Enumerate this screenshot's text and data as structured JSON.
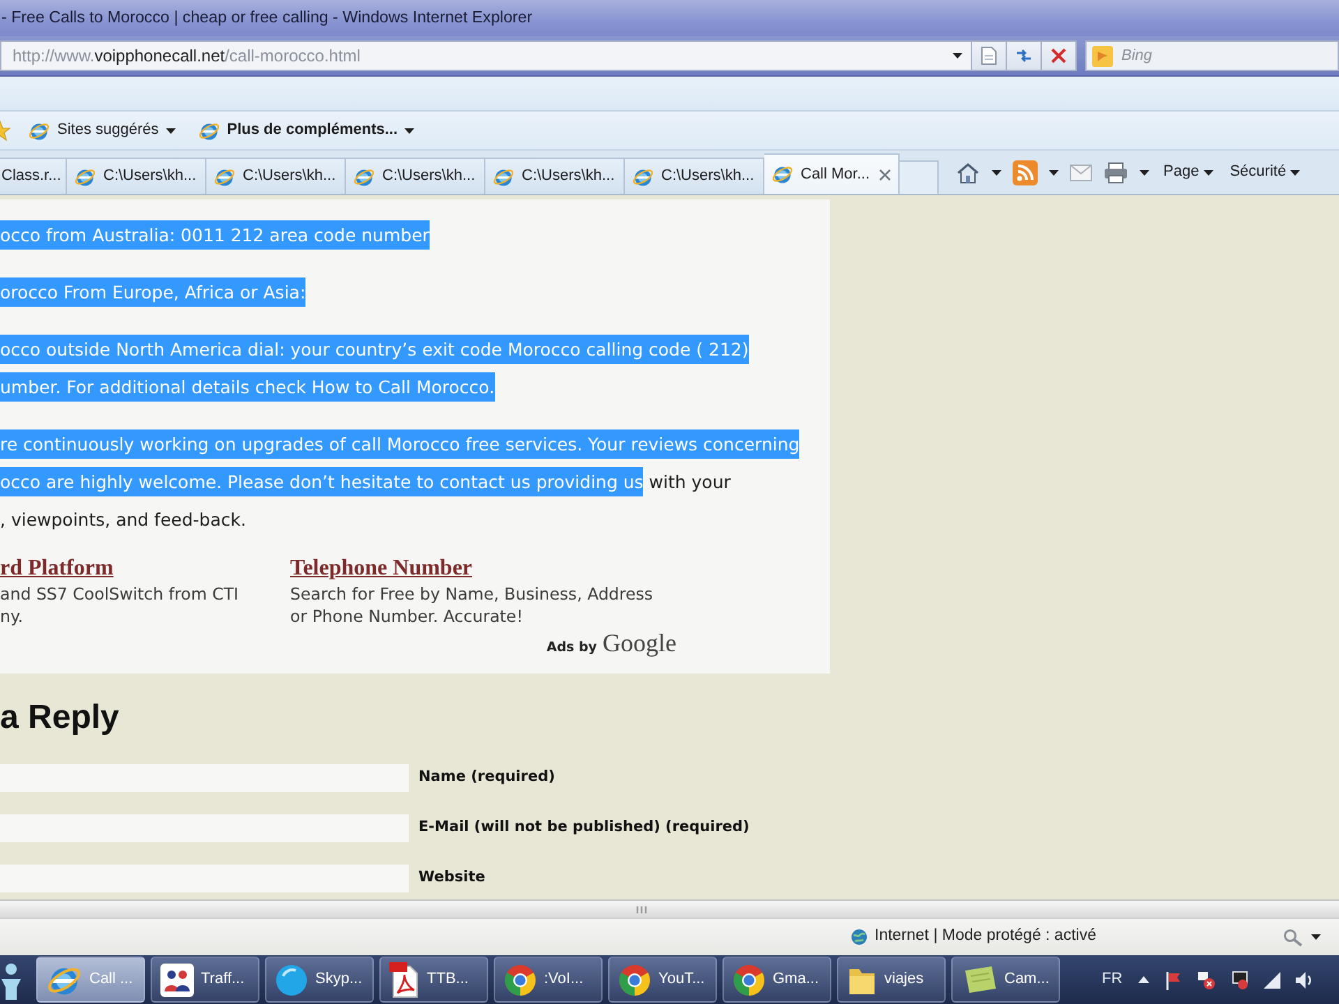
{
  "window": {
    "title": "- Free Calls to Morocco | cheap or free calling - Windows Internet Explorer"
  },
  "address_bar": {
    "url": [
      {
        "text": "http://www.",
        "kind": "dim"
      },
      {
        "text": "voipphonecall.net",
        "kind": "host"
      },
      {
        "text": "/call-morocco.html",
        "kind": "dim"
      }
    ]
  },
  "search": {
    "placeholder": "Bing"
  },
  "favorites_bar": {
    "items": [
      {
        "label": "Sites suggérés",
        "bold": false
      },
      {
        "label": "Plus de compléments...",
        "bold": true
      }
    ]
  },
  "tabs": [
    {
      "label": "Class.r...",
      "kind": "clipped",
      "selected": false
    },
    {
      "label": "C:\\Users\\kh...",
      "kind": "page",
      "selected": false
    },
    {
      "label": "C:\\Users\\kh...",
      "kind": "page",
      "selected": false
    },
    {
      "label": "C:\\Users\\kh...",
      "kind": "page",
      "selected": false
    },
    {
      "label": "C:\\Users\\kh...",
      "kind": "page",
      "selected": false
    },
    {
      "label": "C:\\Users\\kh...",
      "kind": "page",
      "selected": false
    },
    {
      "label": "Call Mor...",
      "kind": "page",
      "selected": true
    }
  ],
  "command_bar": {
    "menus": [
      "Page",
      "Sécurité"
    ]
  },
  "article": {
    "paragraphs": [
      {
        "segments": [
          {
            "text": "occo from Australia: 0011 212 area code number",
            "selected": true
          }
        ]
      },
      {
        "segments": [
          {
            "text": "orocco From Europe, Africa or Asia:",
            "selected": true
          }
        ]
      },
      {
        "segments": [
          {
            "text": "occo outside North America dial: your country’s exit code Morocco calling code ( 212)\number. For additional details check How to Call Morocco.",
            "selected": true
          }
        ]
      },
      {
        "segments": [
          {
            "text": "re continuously working on upgrades of call Morocco free services. Your reviews concerning\nocco are highly welcome. Please don’t hesitate to contact us providing us",
            "selected": true
          },
          {
            "text": " with your\n, viewpoints, and feed-back.",
            "selected": false
          }
        ]
      }
    ]
  },
  "ads": {
    "items": [
      {
        "title": "rd Platform",
        "description": "and SS7 CoolSwitch from CTI\nny."
      },
      {
        "title": "Telephone Number",
        "description": "Search for Free by Name, Business, Address\nor Phone Number. Accurate!"
      }
    ],
    "label": "Ads by",
    "brand": "Google"
  },
  "reply_form": {
    "heading": "a Reply",
    "fields": [
      {
        "label": "Name (required)"
      },
      {
        "label": "E-Mail (will not be published) (required)"
      },
      {
        "label": "Website"
      }
    ]
  },
  "status_bar": {
    "zone": "Internet | Mode protégé : activé"
  },
  "taskbar": {
    "items": [
      {
        "label": "Call ...",
        "kind": "ie",
        "selected": true
      },
      {
        "label": "Traff...",
        "kind": "people",
        "selected": false
      },
      {
        "label": "Skyp...",
        "kind": "skype",
        "selected": false
      },
      {
        "label": "TTB...",
        "kind": "pdf",
        "selected": false
      },
      {
        "label": ":VoI...",
        "kind": "chrome",
        "selected": false
      },
      {
        "label": "YouT...",
        "kind": "chrome",
        "selected": false
      },
      {
        "label": "Gma...",
        "kind": "chrome",
        "selected": false
      },
      {
        "label": "viajes",
        "kind": "folder",
        "selected": false
      },
      {
        "label": "Cam...",
        "kind": "notes",
        "selected": false
      }
    ],
    "language": "FR"
  }
}
